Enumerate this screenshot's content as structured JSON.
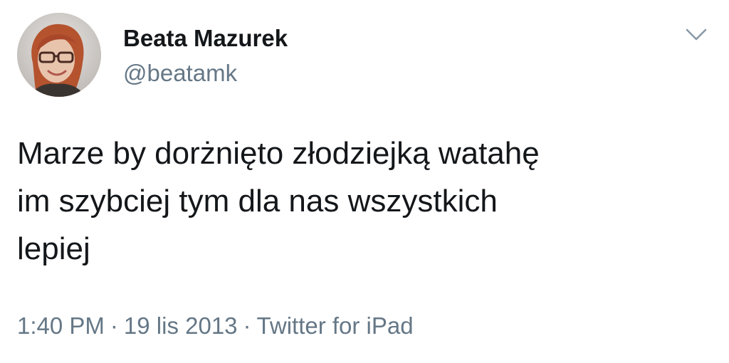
{
  "author": {
    "display_name": "Beata Mazurek",
    "handle": "@beatamk",
    "avatar_icon": "profile-photo"
  },
  "tweet": {
    "text": "Marze by dorżnięto złodziejką watahę\nim szybciej tym dla nas wszystkich\nlepiej"
  },
  "meta": {
    "time": "1:40 PM",
    "separator": "·",
    "date": "19 lis 2013",
    "source": "Twitter for iPad"
  },
  "menu": {
    "icon": "chevron-down-icon"
  },
  "colors": {
    "text_primary": "#14171a",
    "text_secondary": "#657786",
    "background": "#ffffff"
  }
}
